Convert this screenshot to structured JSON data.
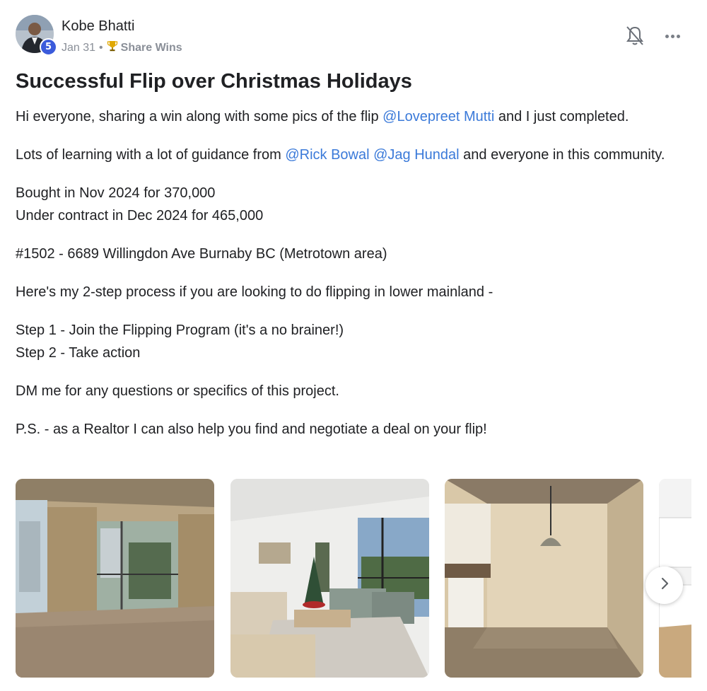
{
  "author": {
    "name": "Kobe Bhatti",
    "level": "5",
    "avatar_icon": "avatar-photo"
  },
  "meta": {
    "date": "Jan 31",
    "separator": "•",
    "category_icon": "trophy-icon",
    "category": "Share Wins"
  },
  "actions": {
    "notify_icon": "bell-off-icon",
    "more_icon": "more-horizontal-icon"
  },
  "post": {
    "title": "Successful Flip over Christmas Holidays",
    "p1_pre": "Hi everyone, sharing a win along with some pics of the flip ",
    "p1_mention": "@Lovepreet Mutti",
    "p1_post": " and I just completed.",
    "p2_pre": "Lots of learning with a lot of guidance from ",
    "p2_mention1": "@Rick Bowal",
    "p2_space": " ",
    "p2_mention2": "@Jag Hundal",
    "p2_post": " and everyone in this community.",
    "p3_line1": "Bought in Nov 2024 for 370,000",
    "p3_line2": "Under contract in Dec 2024 for 465,000",
    "p4": "#1502 - 6689 Willingdon Ave Burnaby BC (Metrotown area)",
    "p5": "Here's my 2-step process if you are looking to do flipping in lower mainland -",
    "p6_line1": "Step 1 - Join the Flipping Program (it's a no brainer!)",
    "p6_line2": "Step 2 - Take action",
    "p7": "DM me for any questions or specifics of this project.",
    "p8": "P.S. - as a Realtor I can also help you find and negotiate a deal on your flip!"
  },
  "gallery": {
    "photos": [
      "empty-living-room-photo",
      "staged-living-room-christmas-tree-photo",
      "dining-area-pendant-light-photo",
      "kitchen-photo"
    ],
    "next_icon": "chevron-right-icon"
  }
}
